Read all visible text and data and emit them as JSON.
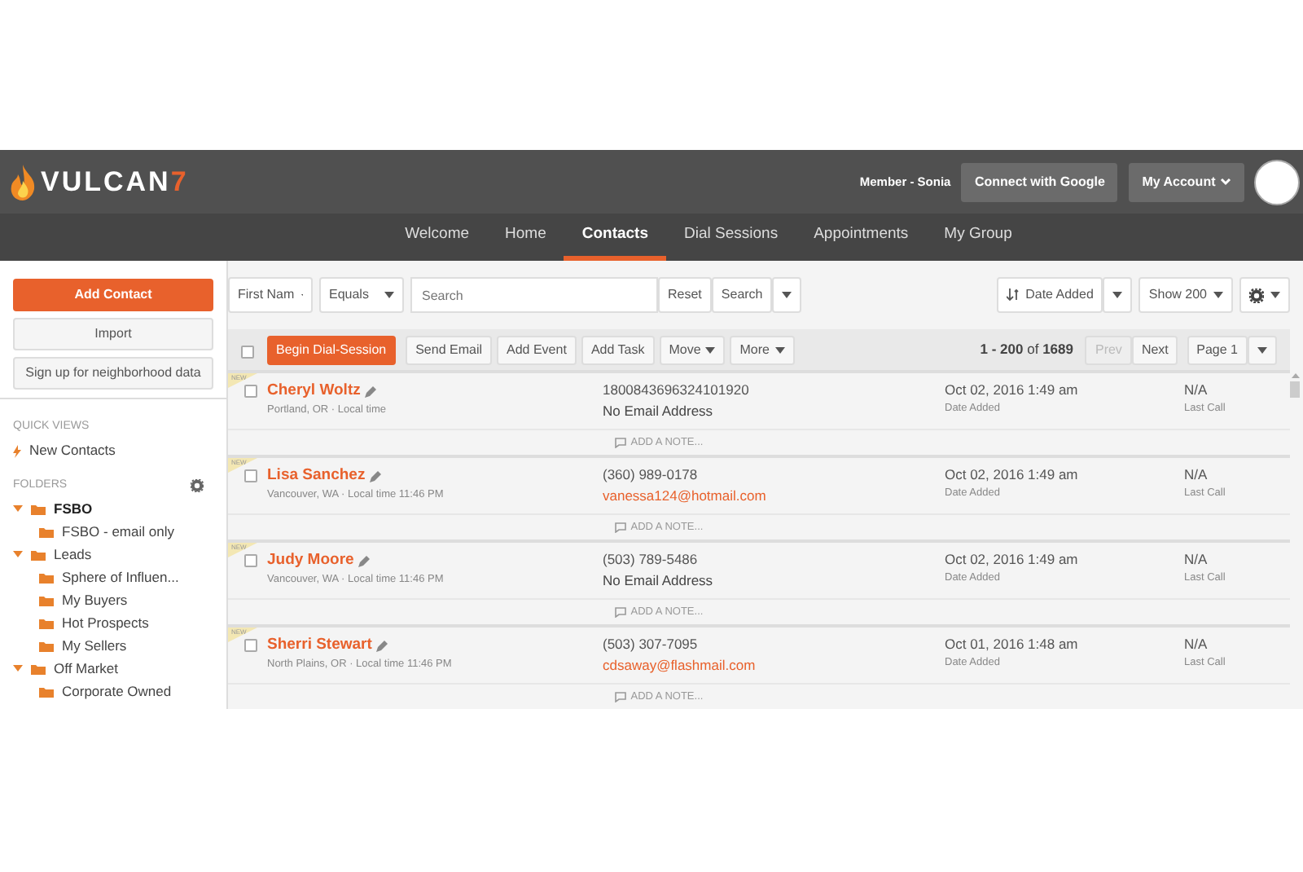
{
  "header": {
    "logo": {
      "text": "VULCAN",
      "accent": "7"
    },
    "member": "Member - Sonia",
    "connect_button": "Connect with Google",
    "account_button": "My Account"
  },
  "nav": [
    {
      "label": "Welcome",
      "selected": false
    },
    {
      "label": "Home",
      "selected": false
    },
    {
      "label": "Contacts",
      "selected": true
    },
    {
      "label": "Dial Sessions",
      "selected": false
    },
    {
      "label": "Appointments",
      "selected": false
    },
    {
      "label": "My Group",
      "selected": false
    }
  ],
  "sidebar": {
    "buttons": [
      {
        "label": "Add Contact",
        "kind": "primary"
      },
      {
        "label": "Import",
        "kind": "plain"
      },
      {
        "label": "Sign up for neighborhood data",
        "kind": "plain"
      }
    ],
    "quick_views": {
      "title": "QUICK VIEWS",
      "items": [
        {
          "label": "New Contacts"
        }
      ]
    },
    "folders": {
      "title": "FOLDERS",
      "items": [
        {
          "label": "FSBO",
          "selected": true,
          "expanded": true,
          "children": [
            {
              "label": "FSBO - email only",
              "selected": false
            }
          ]
        },
        {
          "label": "Leads",
          "selected": false,
          "expanded": true,
          "children": [
            {
              "label": "Sphere of Influen...",
              "selected": false
            },
            {
              "label": "My Buyers",
              "selected": false
            },
            {
              "label": "Hot Prospects",
              "selected": false
            },
            {
              "label": "My Sellers",
              "selected": false
            }
          ]
        },
        {
          "label": "Off Market",
          "selected": false,
          "expanded": true,
          "children": [
            {
              "label": "Corporate Owned",
              "selected": false
            }
          ]
        }
      ]
    }
  },
  "filter": {
    "field": "First Nam",
    "operator": "Equals",
    "search": {
      "placeholder": "Search"
    },
    "reset": "Reset",
    "search_button": "Search",
    "sort": "Date Added",
    "show": "Show 200"
  },
  "actions": {
    "select_all": {
      "checked": false
    },
    "buttons": [
      {
        "label": "Begin Dial-Session",
        "kind": "primary"
      },
      {
        "label": "Send Email",
        "kind": "plain"
      },
      {
        "label": "Add Event",
        "kind": "plain"
      },
      {
        "label": "Add Task",
        "kind": "plain"
      },
      {
        "label": "Move",
        "kind": "menu"
      },
      {
        "label": "More",
        "kind": "menu"
      }
    ],
    "range": "**1 - 200** of **1689**",
    "pages": [
      {
        "label": "Prev",
        "disabled": true
      },
      {
        "label": "Next",
        "disabled": false
      }
    ],
    "page": "Page 1"
  },
  "contacts": [
    {
      "badge": "NEW",
      "checked": false,
      "name": "Cheryl Woltz",
      "location": "Portland, OR · Local time",
      "phone": "1800843696324101920",
      "email": "No Email Address",
      "email_link": false,
      "date": "Oct 02, 2016 1:49 am",
      "date_label": "Date Added",
      "last_call": "N/A",
      "last_call_label": "Last Call",
      "note": "ADD A NOTE..."
    },
    {
      "badge": "NEW",
      "checked": false,
      "name": "Lisa Sanchez",
      "location": "Vancouver, WA · Local time 11:46 PM",
      "phone": "(360) 989-0178",
      "email": "vanessa124@hotmail.com",
      "email_link": true,
      "date": "Oct 02, 2016 1:49 am",
      "date_label": "Date Added",
      "last_call": "N/A",
      "last_call_label": "Last Call",
      "note": "ADD A NOTE..."
    },
    {
      "badge": "NEW",
      "checked": false,
      "name": "Judy Moore",
      "location": "Vancouver, WA · Local time 11:46 PM",
      "phone": "(503) 789-5486",
      "email": "No Email Address",
      "email_link": false,
      "date": "Oct 02, 2016 1:49 am",
      "date_label": "Date Added",
      "last_call": "N/A",
      "last_call_label": "Last Call",
      "note": "ADD A NOTE..."
    },
    {
      "badge": "NEW",
      "checked": false,
      "name": "Sherri Stewart",
      "location": "North Plains, OR · Local time 11:46 PM",
      "phone": "(503) 307-7095",
      "email": "cdsaway@flashmail.com",
      "email_link": true,
      "date": "Oct 01, 2016 1:48 am",
      "date_label": "Date Added",
      "last_call": "N/A",
      "last_call_label": "Last Call",
      "note": "ADD A NOTE..."
    }
  ]
}
